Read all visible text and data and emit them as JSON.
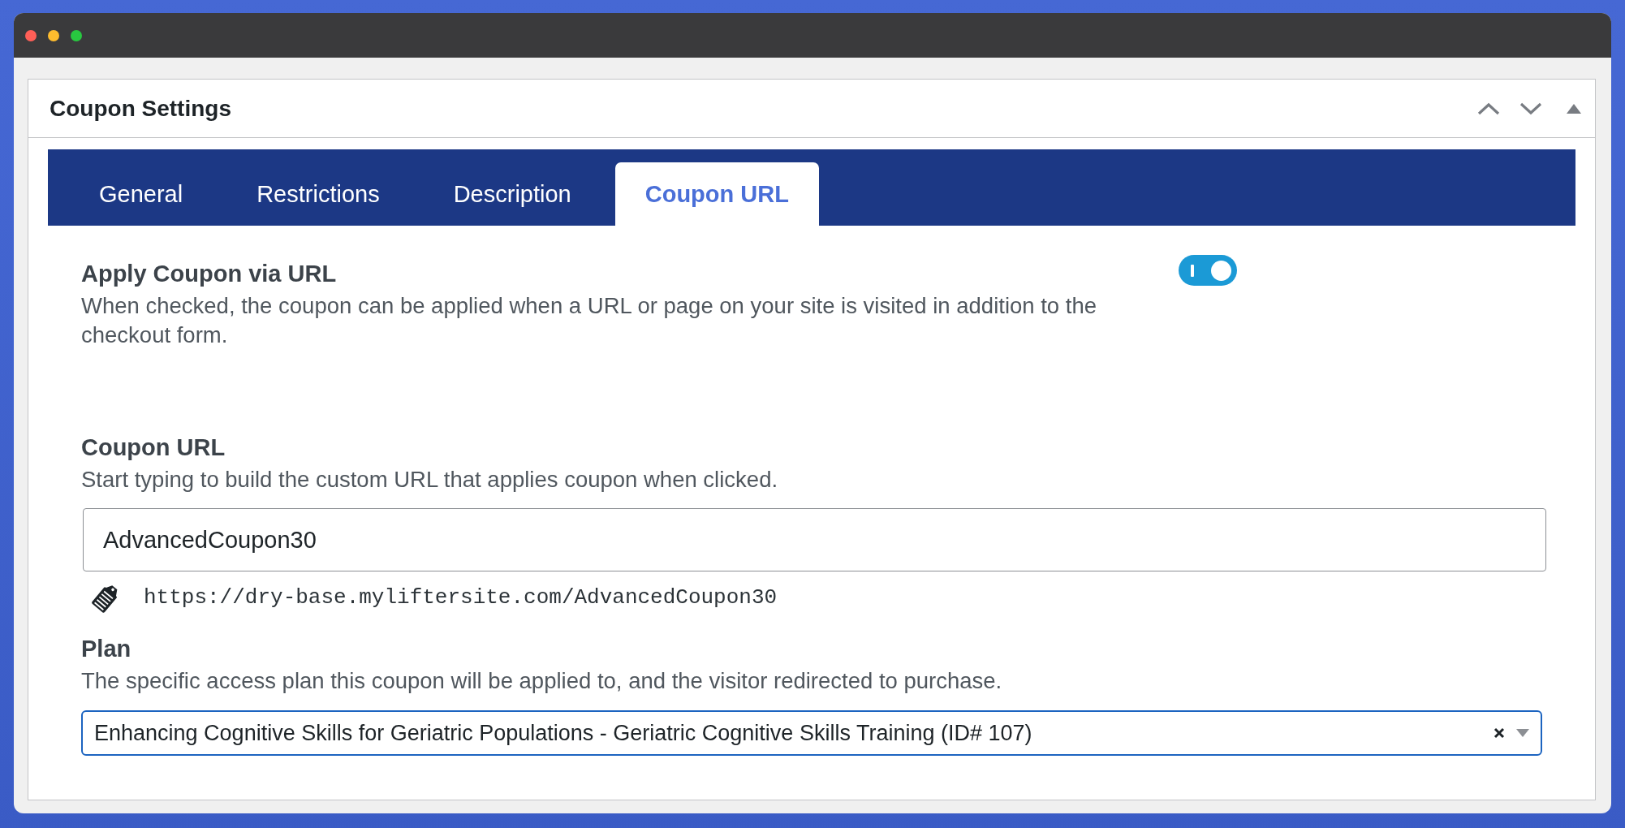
{
  "panel": {
    "title": "Coupon Settings"
  },
  "tabs": [
    {
      "label": "General",
      "selected": false
    },
    {
      "label": "Restrictions",
      "selected": false
    },
    {
      "label": "Description",
      "selected": false
    },
    {
      "label": "Coupon URL",
      "selected": true
    }
  ],
  "settings": [
    {
      "kind": "toggle",
      "label": "Apply Coupon via URL",
      "description": "When checked, the coupon can be applied when a URL or page on your site is visited in addition to the checkout form.",
      "on": true
    },
    {
      "kind": "text",
      "label": "Coupon URL",
      "description": "Start typing to build the custom URL that applies coupon when clicked.",
      "value": "AdvancedCoupon30",
      "preview": "https://dry-base.myliftersite.com/AdvancedCoupon30"
    },
    {
      "kind": "select",
      "label": "Plan",
      "description": "The specific access plan this coupon will be applied to, and the visitor redirected to purchase.",
      "value": "Enhancing Cognitive Skills for Geriatric Populations - Geriatric Cognitive Skills Training (ID# 107)",
      "focused": true
    }
  ]
}
